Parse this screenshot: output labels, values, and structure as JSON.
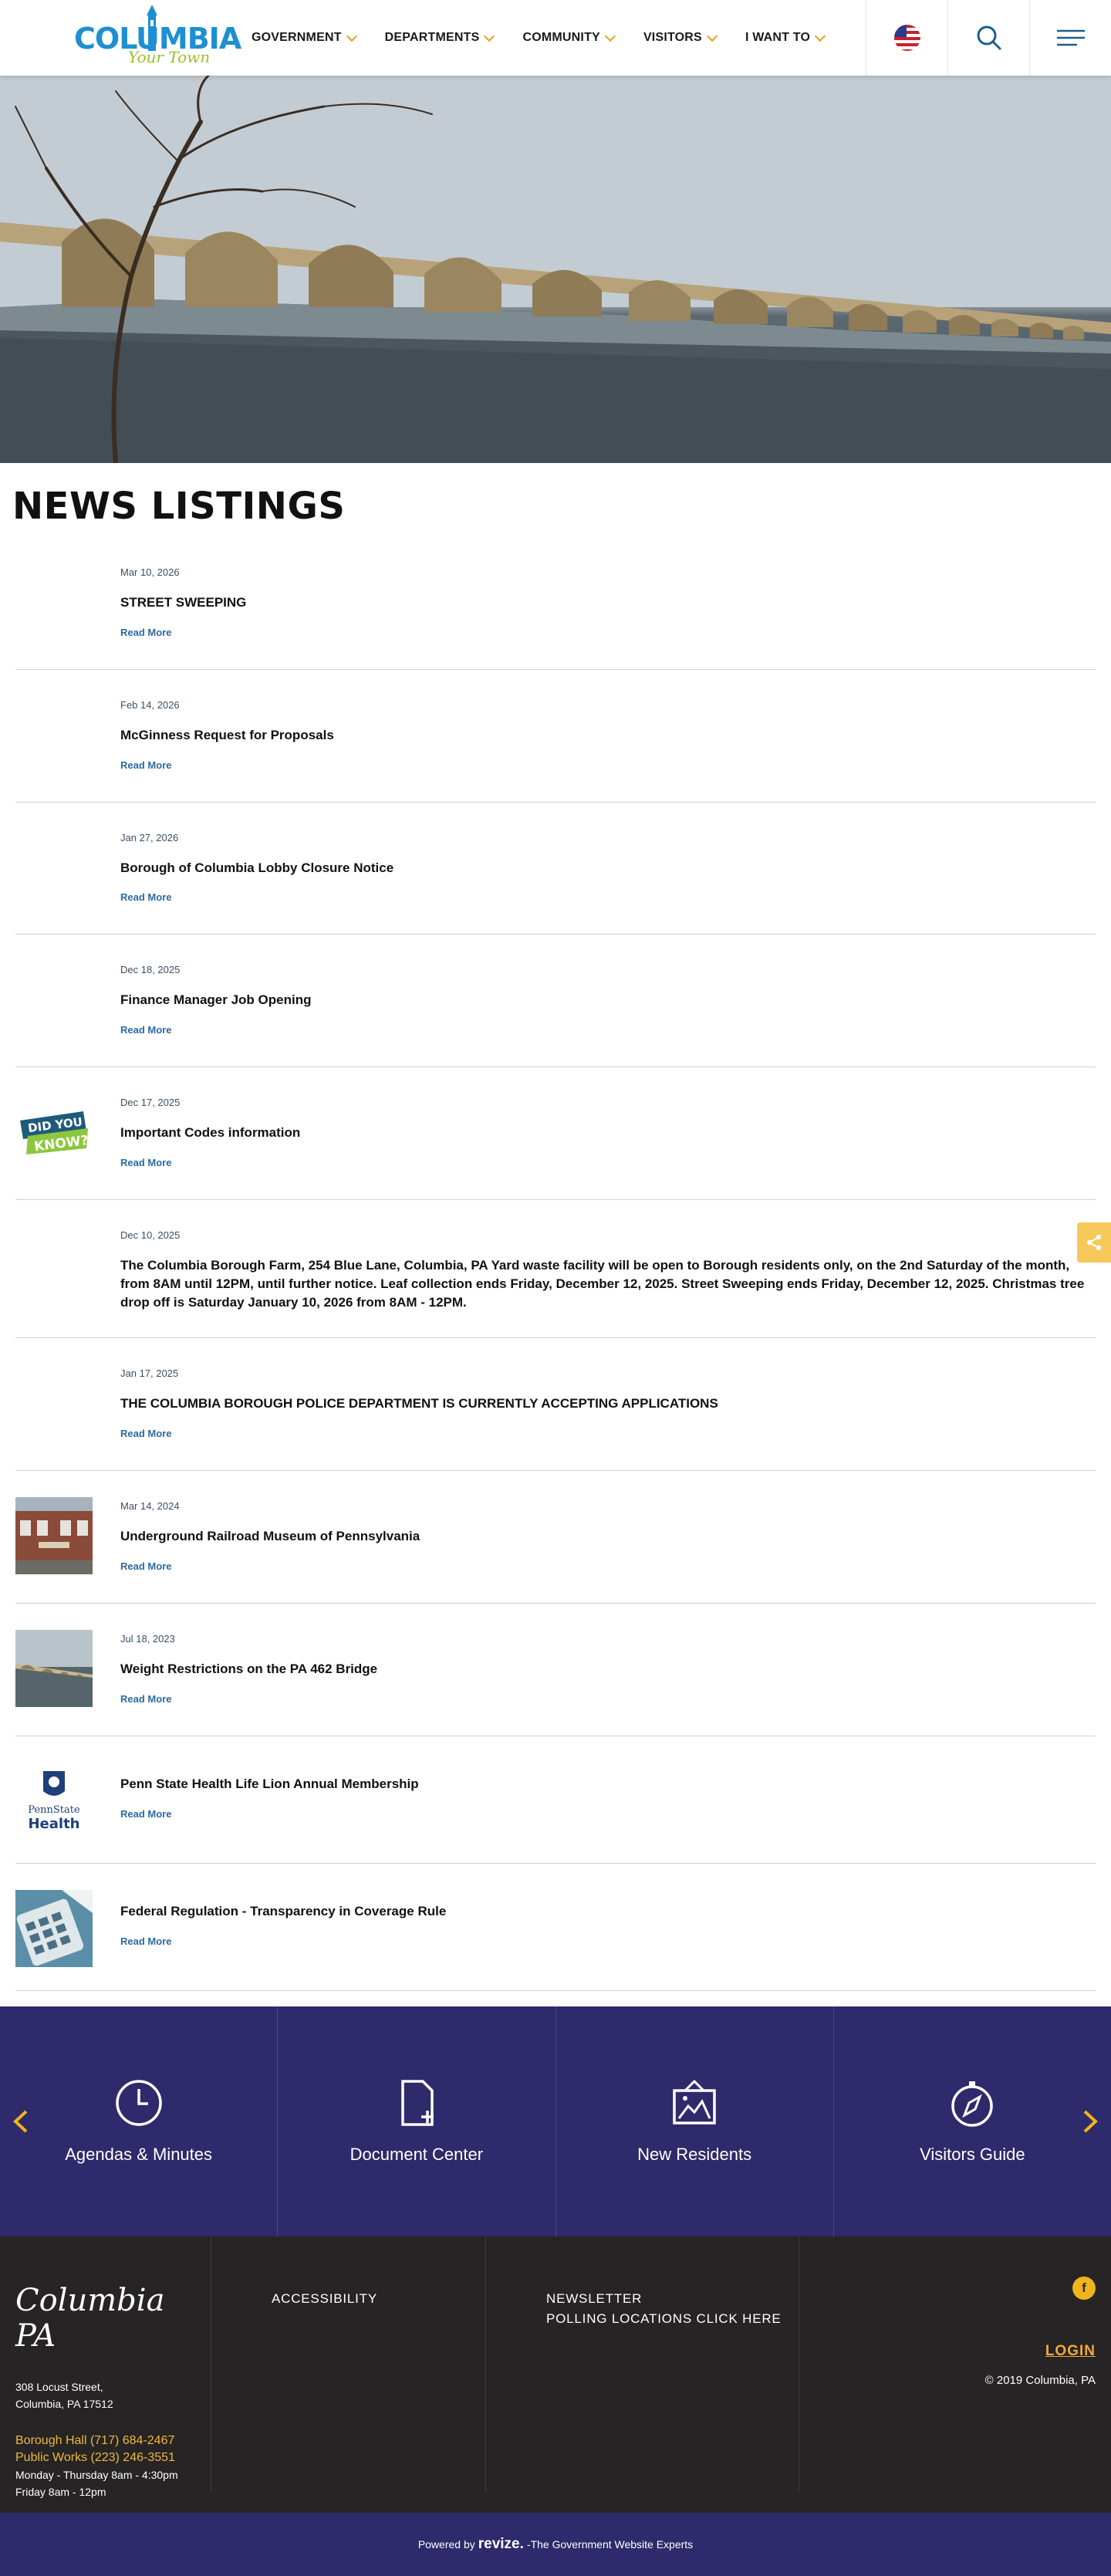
{
  "header": {
    "logo_main": "COLUMBIA",
    "logo_sub": "Your Town",
    "nav": [
      "GOVERNMENT",
      "DEPARTMENTS",
      "COMMUNITY",
      "VISITORS",
      "I WANT TO"
    ],
    "icons": [
      "flag-icon",
      "search-icon",
      "menu-icon"
    ]
  },
  "news": {
    "title": "NEWS LISTINGS",
    "read_more": "Read More",
    "items": [
      {
        "date": "Mar 10, 2026",
        "headline": "STREET SWEEPING",
        "thumb": ""
      },
      {
        "date": "Feb 14, 2026",
        "headline": "McGinness Request for Proposals",
        "thumb": ""
      },
      {
        "date": "Jan 27, 2026",
        "headline": "Borough of Columbia Lobby Closure Notice",
        "thumb": ""
      },
      {
        "date": "Dec 18, 2025",
        "headline": "Finance Manager Job Opening",
        "thumb": ""
      },
      {
        "date": "Dec 17, 2025",
        "headline": "Important Codes information",
        "thumb": "did-you-know"
      },
      {
        "date": "Dec 10, 2025",
        "headline": "The Columbia Borough Farm, 254 Blue Lane, Columbia, PA Yard waste facility will be open to Borough residents only, on the 2nd  Saturday of the month, from 8AM until 12PM, until further notice. Leaf collection ends Friday, December 12, 2025. Street Sweeping ends Friday, December 12, 2025. Christmas tree drop off is Saturday January 10, 2026 from 8AM - 12PM.",
        "thumb": ""
      },
      {
        "date": "Jan 17, 2025",
        "headline": "THE COLUMBIA BOROUGH POLICE DEPARTMENT IS CURRENTLY ACCEPTING APPLICATIONS",
        "thumb": ""
      },
      {
        "date": "Mar 14, 2024",
        "headline": "Underground Railroad Museum of Pennsylvania",
        "thumb": "museum"
      },
      {
        "date": "Jul 18, 2023",
        "headline": "Weight Restrictions on the PA 462 Bridge",
        "thumb": "bridge"
      },
      {
        "date": "",
        "headline": "Penn State Health Life Lion Annual Membership",
        "thumb": "psh"
      },
      {
        "date": "",
        "headline": "Federal Regulation - Transparency in Coverage Rule",
        "thumb": "calc"
      }
    ],
    "did_you_know_line1": "DID YOU",
    "did_you_know_line2": "KNOW?",
    "psh_line1": "PennState",
    "psh_line2": "Health"
  },
  "quick_links": [
    {
      "label": "Agendas & Minutes",
      "icon": "clock-icon"
    },
    {
      "label": "Document Center",
      "icon": "document-add-icon"
    },
    {
      "label": "New Residents",
      "icon": "picture-frame-icon"
    },
    {
      "label": "Visitors Guide",
      "icon": "compass-icon"
    }
  ],
  "footer": {
    "brand": "Columbia PA",
    "address_line1": "308 Locust Street,",
    "address_line2": "Columbia, PA 17512",
    "phone1": "Borough Hall (717) 684-2467",
    "phone2": "Public Works (223) 246-3551",
    "hours1": "Monday - Thursday 8am - 4:30pm",
    "hours2": "Friday 8am - 12pm",
    "links_col2": [
      "ACCESSIBILITY"
    ],
    "links_col3": [
      "NEWSLETTER",
      "POLLING LOCATIONS CLICK HERE"
    ],
    "facebook": "f",
    "login": "LOGIN",
    "copyright": "© 2019 Columbia, PA"
  },
  "bottom": {
    "powered_by": "Powered by",
    "brand": "revize.",
    "tagline": "-The Government Website Experts"
  },
  "colors": {
    "accent_orange": "#e8a020",
    "nav_purple": "#2e2a6b",
    "link_blue": "#2b6aa3",
    "footer_dark": "#262424",
    "gold": "#f0b73b"
  }
}
